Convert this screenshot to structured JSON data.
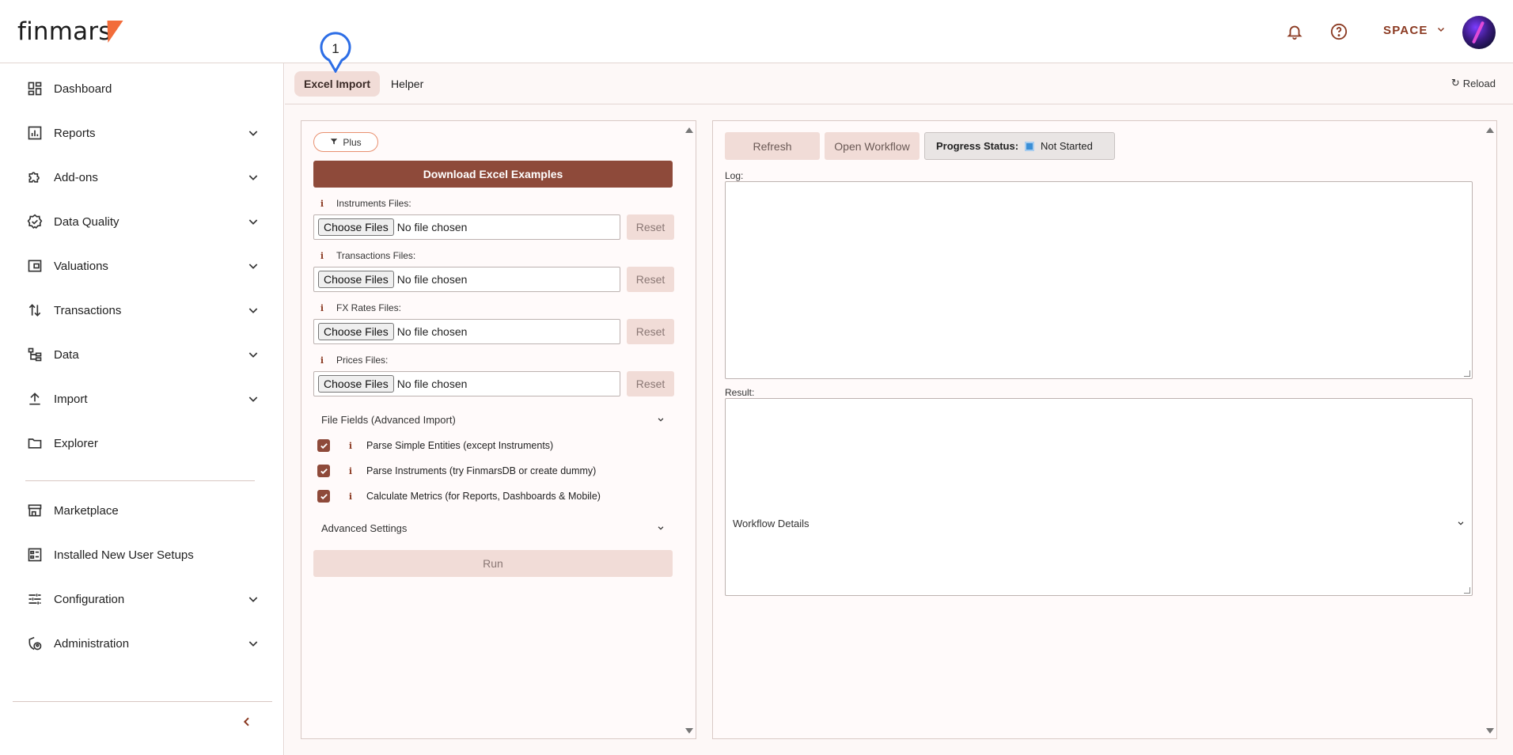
{
  "header": {
    "logo_text": "finmars",
    "space_label": "SPACE",
    "brand_color": "#f26c3a",
    "accent_color": "#8e4a3a",
    "icons": [
      "bell-icon",
      "help-icon",
      "chevron-down-icon"
    ]
  },
  "sidebar": {
    "items": [
      {
        "label": "Dashboard",
        "icon": "dashboard-icon",
        "has_chevron": false
      },
      {
        "label": "Reports",
        "icon": "reports-icon",
        "has_chevron": true
      },
      {
        "label": "Add-ons",
        "icon": "puzzle-icon",
        "has_chevron": true
      },
      {
        "label": "Data Quality",
        "icon": "badge-check-icon",
        "has_chevron": true
      },
      {
        "label": "Valuations",
        "icon": "wallet-icon",
        "has_chevron": true
      },
      {
        "label": "Transactions",
        "icon": "swap-vertical-icon",
        "has_chevron": true
      },
      {
        "label": "Data",
        "icon": "data-tree-icon",
        "has_chevron": true
      },
      {
        "label": "Import",
        "icon": "upload-icon",
        "has_chevron": true
      },
      {
        "label": "Explorer",
        "icon": "folder-icon",
        "has_chevron": false
      },
      {
        "label": "Marketplace",
        "icon": "store-icon",
        "has_chevron": false
      },
      {
        "label": "Installed New User Setups",
        "icon": "list-box-icon",
        "has_chevron": false
      },
      {
        "label": "Configuration",
        "icon": "sliders-icon",
        "has_chevron": true
      },
      {
        "label": "Administration",
        "icon": "admin-shield-icon",
        "has_chevron": true
      }
    ]
  },
  "tabs": {
    "items": [
      {
        "label": "Excel Import",
        "active": true
      },
      {
        "label": "Helper",
        "active": false
      }
    ],
    "reload_label": "Reload",
    "marker_number": "1"
  },
  "left_panel": {
    "plus_label": "Plus",
    "download_label": "Download Excel Examples",
    "file_fields": [
      {
        "label": "Instruments Files:",
        "choose": "Choose Files",
        "status": "No file chosen",
        "reset": "Reset"
      },
      {
        "label": "Transactions Files:",
        "choose": "Choose Files",
        "status": "No file chosen",
        "reset": "Reset"
      },
      {
        "label": "FX Rates Files:",
        "choose": "Choose Files",
        "status": "No file chosen",
        "reset": "Reset"
      },
      {
        "label": "Prices Files:",
        "choose": "Choose Files",
        "status": "No file chosen",
        "reset": "Reset"
      }
    ],
    "file_fields_section": "File Fields (Advanced Import)",
    "options": [
      {
        "label": "Parse Simple Entities (except Instruments)",
        "checked": true
      },
      {
        "label": "Parse Instruments (try FinmarsDB or create dummy)",
        "checked": true
      },
      {
        "label": "Calculate Metrics (for Reports, Dashboards & Mobile)",
        "checked": true
      }
    ],
    "advanced_section": "Advanced Settings",
    "run_label": "Run"
  },
  "right_panel": {
    "refresh_label": "Refresh",
    "open_workflow_label": "Open Workflow",
    "progress_label": "Progress Status:",
    "progress_value": "Not Started",
    "log_label": "Log:",
    "log_value": "",
    "result_label": "Result:",
    "result_value": "",
    "workflow_details_label": "Workflow Details"
  }
}
